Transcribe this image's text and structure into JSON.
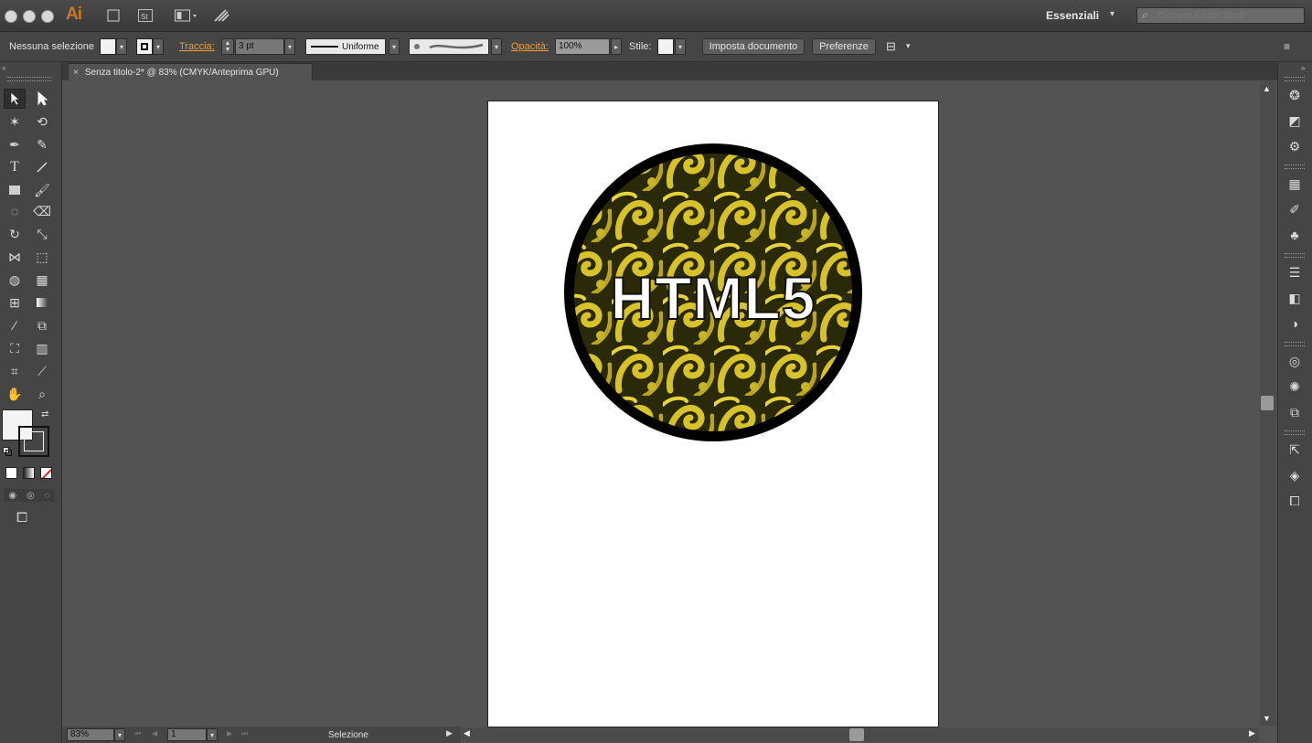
{
  "app": {
    "logo": "Ai",
    "workspace": "Essenziali",
    "search_placeholder": "Cerca in Adobe Stock"
  },
  "control_bar": {
    "selection_label": "Nessuna selezione",
    "stroke_label": "Traccia:",
    "stroke_value": "3 pt",
    "profile_label": "Uniforme",
    "opacity_label": "Opacità:",
    "opacity_value": "100%",
    "style_label": "Stile:",
    "doc_setup_button": "Imposta documento",
    "prefs_button": "Preferenze"
  },
  "document": {
    "tab_title": "Senza titolo-2* @ 83% (CMYK/Anteprima GPU)"
  },
  "artwork": {
    "badge_text": "HTML5",
    "pattern_color": "#d8c22a",
    "ring_color": "#000000"
  },
  "status": {
    "zoom": "83%",
    "artboard": "1",
    "tool_name": "Selezione"
  },
  "colors": {
    "fill": "#ffffff",
    "stroke": "#000000",
    "accent": "#e8a040"
  }
}
